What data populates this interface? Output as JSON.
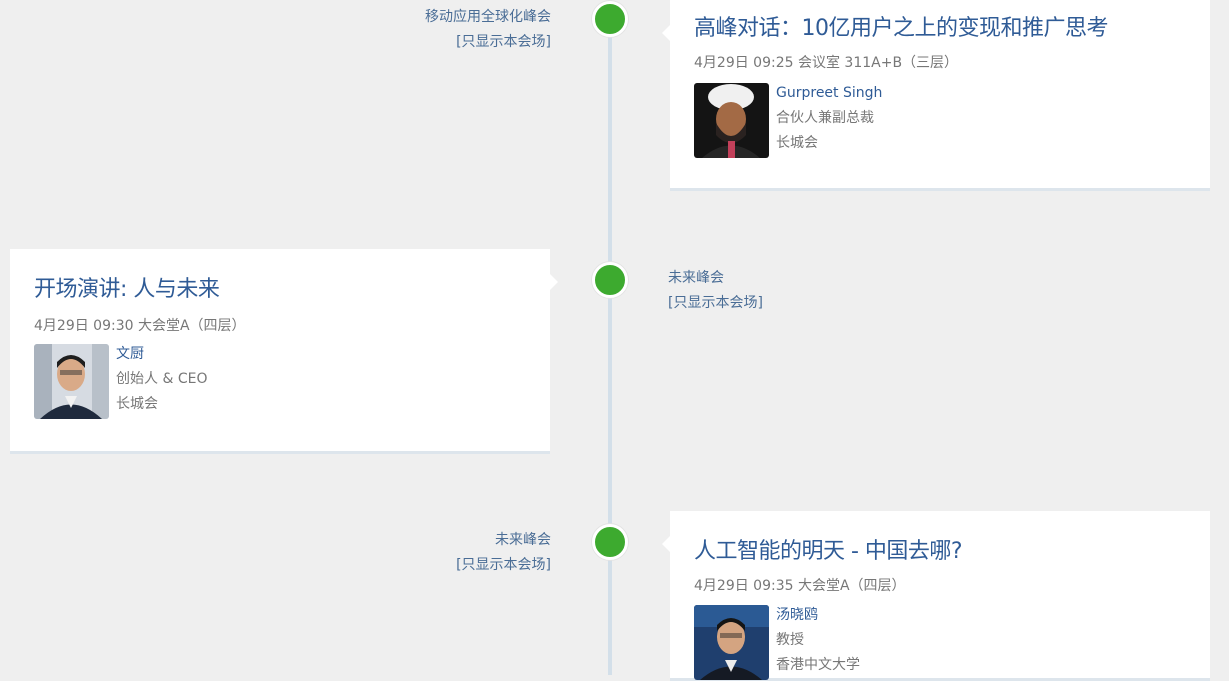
{
  "sessions": [
    {
      "venue": "移动应用全球化峰会",
      "filter_label": "[只显示本会场]",
      "title": "高峰对话：10亿用户之上的变现和推广思考",
      "meta": "4月29日 09:25 会议室 311A+B（三层）",
      "speaker": {
        "name": "Gurpreet Singh",
        "role": "合伙人兼副总裁",
        "org": "长城会"
      }
    },
    {
      "venue": "未来峰会",
      "filter_label": "[只显示本会场]",
      "title": "开场演讲: 人与未来",
      "meta": "4月29日 09:30 大会堂A（四层）",
      "speaker": {
        "name": "文厨",
        "role": "创始人 & CEO",
        "org": "长城会"
      }
    },
    {
      "venue": "未来峰会",
      "filter_label": "[只显示本会场]",
      "title": "人工智能的明天 - 中国去哪?",
      "meta": "4月29日 09:35 大会堂A（四层）",
      "speaker": {
        "name": "汤晓鸥",
        "role": "教授",
        "org": "香港中文大学"
      }
    }
  ],
  "colors": {
    "accent": "#2f5b96",
    "dot": "#3daa2f",
    "timeline": "#d3dfe9",
    "background": "#efefef"
  }
}
